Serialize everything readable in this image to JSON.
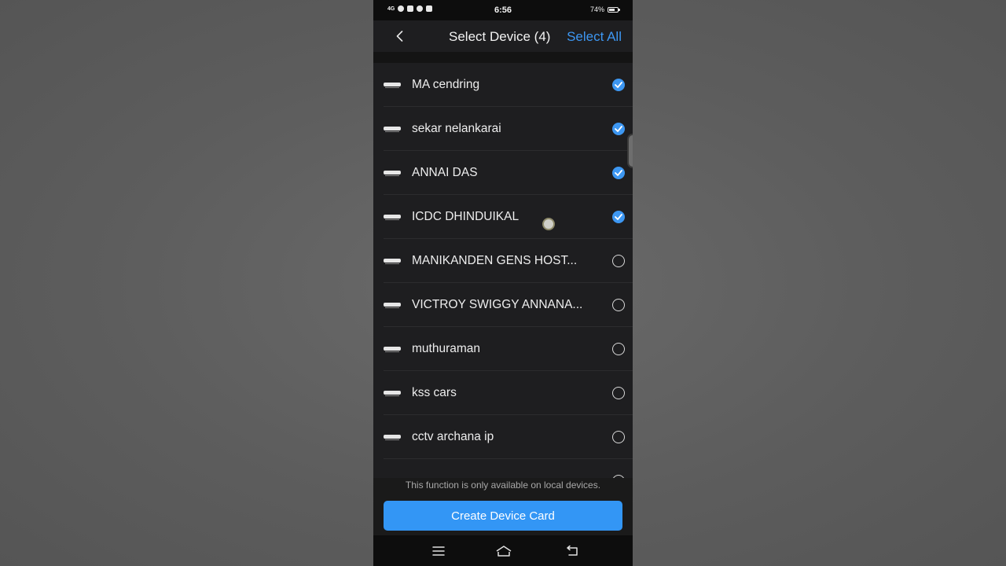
{
  "status_bar": {
    "network": "4G",
    "time": "6:56",
    "battery": "74%",
    "battery_level": 0.74
  },
  "header": {
    "title": "Select Device (4)",
    "select_all_label": "Select All"
  },
  "devices": [
    {
      "label": "MA cendring",
      "checked": true
    },
    {
      "label": "sekar nelankarai",
      "checked": true
    },
    {
      "label": "ANNAI DAS",
      "checked": true
    },
    {
      "label": "ICDC DHINDUIKAL",
      "checked": true
    },
    {
      "label": "MANIKANDEN GENS HOST...",
      "checked": false
    },
    {
      "label": "VICTROY SWIGGY ANNANA...",
      "checked": false
    },
    {
      "label": "muthuraman",
      "checked": false
    },
    {
      "label": "kss cars",
      "checked": false
    },
    {
      "label": "cctv archana ip",
      "checked": false
    },
    {
      "label": "",
      "checked": false
    }
  ],
  "footer": {
    "note": "This function is only available on local devices.",
    "create_label": "Create Device Card"
  },
  "colors": {
    "accent": "#3d97f2",
    "button": "#3396f5",
    "panel": "#1e1e20"
  },
  "icons": {
    "back": "chevron-left-icon",
    "device": "nvr-device-icon",
    "checked": "check-circle-icon",
    "unchecked": "radio-empty-icon",
    "nav_menu": "menu-icon",
    "nav_home": "home-icon",
    "nav_back": "back-arrow-icon"
  }
}
